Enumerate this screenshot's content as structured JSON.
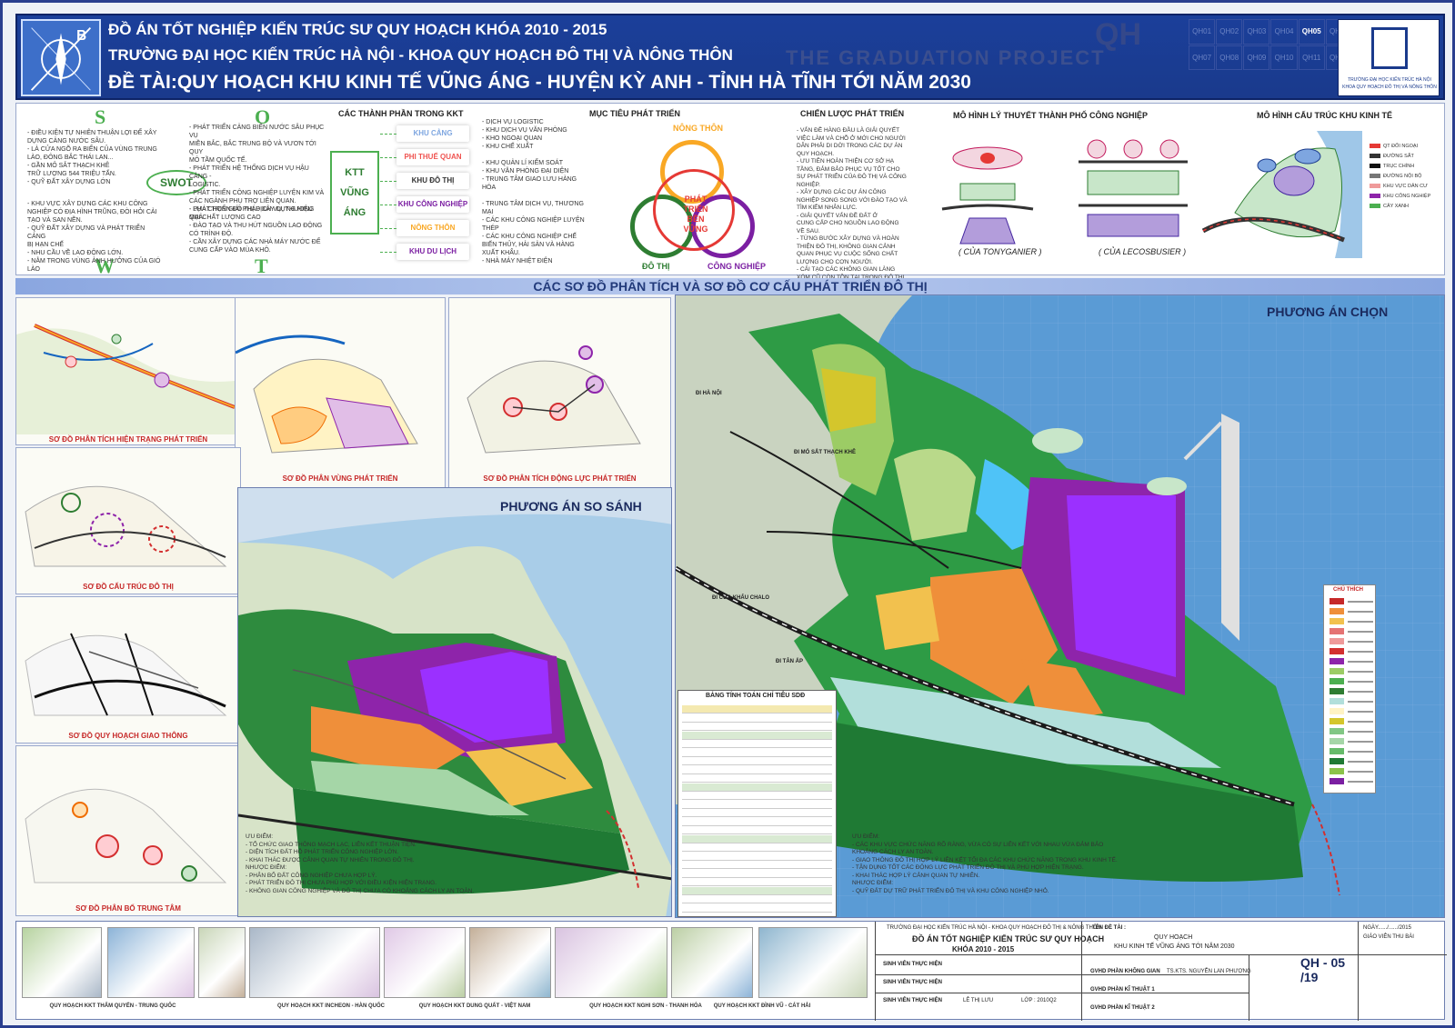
{
  "header": {
    "line1": "ĐỒ ÁN TỐT NGHIỆP KIẾN TRÚC SƯ QUY HOẠCH KHÓA 2010 - 2015",
    "line2": "TRƯỜNG ĐẠI HỌC KIẾN TRÚC HÀ NỘI - KHOA QUY HOẠCH ĐÔ THỊ VÀ NÔNG THÔN",
    "line3": "ĐỀ TÀI:QUY HOẠCH KHU KINH TẾ VŨNG ÁNG - HUYỆN KỲ ANH - TỈNH HÀ TĨNH TỚI NĂM 2030",
    "graduation": "THE GRADUATION PROJECT",
    "qh": "QH",
    "compass_letter": "B",
    "codes": [
      "QH01",
      "QH02",
      "QH03",
      "QH04",
      "QH05",
      "QH06",
      "QH07",
      "QH08",
      "QH09",
      "QH10",
      "QH11",
      "QH12"
    ],
    "active_code": "QH05",
    "logo_text": "TRƯỜNG ĐẠI HỌC KIẾN TRÚC HÀ NỘI\nKHOA QUY HOẠCH ĐÔ THỊ VÀ NÔNG THÔN"
  },
  "swot": {
    "s": "S",
    "o": "O",
    "w": "W",
    "t": "T",
    "center": "SWOT",
    "strengths": "- ĐIỀU KIỆN TỰ NHIÊN THUẬN LỢI ĐỂ XÂY\n  DỰNG CẢNG NƯỚC SÂU.\n- LÀ CỬA NGÕ RA BIỂN CỦA VÙNG TRUNG\n  LÀO, ĐÔNG BẮC THÁI LAN...\n- GẦN MỎ SẮT THẠCH KHÊ\n  TRỮ LƯỢNG 544 TRIỆU TẤN.\n- QUỸ ĐẤT XÂY DỰNG LỚN",
    "opportunities": "- PHÁT TRIỂN CẢNG BIỂN NƯỚC SÂU PHỤC VỤ\n  MIỀN BẮC, BẮC TRUNG BỘ VÀ VƯƠN TỚI QUY\n  MÔ TẦM QUỐC TẾ.\n- PHÁT TRIỂN HỆ THỐNG DỊCH VỤ HẬU CẢNG -\n  LOGISTIC.\n- PHÁT TRIỂN CÔNG NGHIỆP LUYỆN KIM VÀ\n  CÁC NGÀNH PHỤ TRỢ LIÊN QUAN.\n- PHÁT TRIỂN ĐÔ THỊ DỊCH VỤ, THƯƠNG\n  MẠI CHẤT LƯỢNG CAO",
    "weaknesses": "- KHU VỰC XÂY DỰNG CÁC KHU CÔNG\n  NGHIỆP CÓ ĐỊA HÌNH TRŨNG, ĐÒI HỎI CẢI\n  TẠO VÀ SAN NỀN.\n- QUỸ ĐẤT XÂY DỰNG VÀ PHÁT TRIỂN CẢNG\n  BỊ HẠN CHẾ\n- NHU CẦU VỀ LAO ĐỘNG LỚN.\n- NẰM TRONG VÙNG ẢNH HƯỞNG CỦA GIÓ\n  LÀO",
    "threats": "- LỰA CHỌN GIẢI PHÁP XÂY DỰNG HIỆU\n  QUẢ.\n- ĐÀO TẠO VÀ THU HÚT NGUỒN LAO ĐỘNG\n  CÓ TRÌNH ĐỘ.\n- CẦN XÂY DỰNG CÁC NHÀ MÁY NƯỚC ĐỂ\n  CUNG CẤP VÀO MÙA KHÔ."
  },
  "components": {
    "title": "CÁC THÀNH PHẦN TRONG KKT",
    "center": [
      "KTT",
      "VŨNG",
      "ÁNG"
    ],
    "zones": [
      {
        "label": "KHU CẢNG",
        "color": "#7ea6e0"
      },
      {
        "label": "PHI THUẾ QUAN",
        "color": "#ef5350"
      },
      {
        "label": "KHU ĐÔ THỊ",
        "color": "#333333"
      },
      {
        "label": "KHU CÔNG NGHIỆP",
        "color": "#7b1fa2"
      },
      {
        "label": "NÔNG THÔN",
        "color": "#f9a825"
      },
      {
        "label": "KHU DU LỊCH",
        "color": "#7b1fa2"
      }
    ],
    "details": "- DỊCH VỤ LOGISTIC\n- KHU DỊCH VỤ VĂN PHÒNG\n- KHO NGOẠI QUAN\n- KHU CHẾ XUẤT\n\n- KHU QUẢN LÍ KIỂM SOÁT\n- KHU VĂN PHÒNG ĐẠI DIỆN\n- TRUNG TÂM GIAO LƯU HÀNG\n  HÓA\n\n- TRUNG TÂM DỊCH VỤ, THƯƠNG\n  MẠI\n- CÁC KHU CÔNG NGHIỆP LUYỆN\n  THÉP\n- CÁC KHU CÔNG NGHIỆP CHẾ\n  BIẾN THỦY, HẢI SẢN VÀ HÀNG\n  XUẤT KHẨU.\n- NHÀ MÁY NHIỆT ĐIỆN"
  },
  "goals": {
    "title": "MỤC TIÊU PHÁT TRIỂN",
    "center": "PHÁT TRIỂN\nBỀN\nVỮNG",
    "top": "NÔNG THÔN",
    "left": "ĐÔ THỊ",
    "right": "CÔNG NGHIỆP"
  },
  "strategy": {
    "title": "CHIẾN LƯỢC PHÁT TRIỂN",
    "text": "- VẤN ĐỀ HÀNG ĐẦU LÀ GIẢI QUYẾT\n  VIỆC LÀM VÀ CHỖ Ở MỚI CHO NGƯỜI\n  DÂN PHẢI DI DỜI TRONG CÁC DỰ ÁN\n  QUY HOẠCH.\n- ƯU TIÊN HOÀN THIỆN CƠ SỞ HẠ\n  TẦNG, ĐẢM BẢO PHỤC VỤ TỐT CHO\n  SỰ PHÁT TRIỂN CỦA ĐÔ THỊ VÀ CÔNG\n  NGHIỆP.\n- XÂY DỰNG CÁC DỰ ÁN CÔNG\n  NGHIỆP SONG SONG VỚI ĐÀO TẠO VÀ\n  TÌM KIẾM NHÂN LỰC.\n- GIẢI QUYẾT VẤN ĐỀ ĐẤT Ở\n  CUNG CẤP CHO NGUỒN LAO ĐỘNG\n  VỀ SAU.\n- TỪNG BƯỚC XÂY DỰNG VÀ HOÀN\n  THIỆN ĐÔ THỊ, KHÔNG GIAN CẢNH\n  QUAN PHỤC VỤ CUỘC SỐNG CHẤT\n  LƯỢNG CHO CƠN NGƯỜI.\n- CẢI TẠO CÁC KHÔNG GIAN LÀNG\n  XÓM CŨ CÒN TỒN TẠI TRONG ĐÔ THỊ,\n  ĐẢM BẢO SỰ HÀI HÒA VỚI KHÔNG\n  GIAN ĐÔ THỊ."
  },
  "models": {
    "title1": "MÔ HÌNH LÝ THUYẾT THÀNH PHỐ CÔNG NGHIỆP",
    "title2": "MÔ HÌNH CẤU TRÚC KHU KINH TẾ",
    "cap1": "( CỦA TONYGANIER )",
    "cap2": "( CỦA LECOSBUSIER )",
    "legend": [
      "QT ĐỐI NGOẠI",
      "ĐƯỜNG SẮT",
      "TRỤC CHÍNH",
      "ĐƯỜNG NỘI BỘ",
      "KHU VỰC DÂN CƯ",
      "KHU CÔNG NGHIỆP",
      "CÂY XANH"
    ]
  },
  "banner": "CÁC SƠ ĐỒ PHÂN TÍCH VÀ SƠ ĐỒ CƠ CẤU PHÁT TRIỂN ĐÔ THỊ",
  "diagrams": {
    "d1": "SƠ ĐỒ PHÂN TÍCH HIỆN TRẠNG PHÁT TRIỂN",
    "d2": "SƠ ĐỒ PHÂN VÙNG PHÁT TRIỂN",
    "d3": "SƠ ĐỒ PHÂN TÍCH ĐỘNG LỰC PHÁT TRIỂN",
    "d4": "SƠ ĐỒ CẤU TRÚC ĐÔ THỊ",
    "d5": "SƠ ĐỒ QUY HOẠCH GIAO THÔNG",
    "d6": "SƠ ĐỒ PHÂN BỐ TRUNG TÂM"
  },
  "maps": {
    "compare_title": "PHƯƠNG ÁN SO SÁNH",
    "chosen_title": "PHƯƠNG ÁN CHỌN",
    "table_title": "BẢNG TÍNH TOÁN CHỈ TIÊU SDĐ",
    "labels": [
      "ĐI HÀ NỘI",
      "ĐI MỎ SẮT THẠCH KHÊ",
      "ĐI CỬA KHẨU CHALO",
      "ĐI TÂN ẤP"
    ],
    "compare_notes": "ƯU ĐIỂM:\n- TỔ CHỨC GIAO THÔNG MẠCH LẠC, LIÊN KẾT THUẬN TIỆN.\n- DIỆN TÍCH ĐẤT HỖ PHÁT TRIỂN CÔNG NGHIỆP LỚN.\n- KHAI THÁC ĐƯỢC CẢNH QUAN TỰ NHIÊN TRONG ĐÔ THỊ.\nNHƯỢC ĐIỂM:\n- PHÂN BỐ ĐẤT CÔNG NGHIỆP CHƯA HỢP LÝ.\n- PHÁT TRIỂN ĐÔ THỊ CHƯA PHÙ HỢP VỚI ĐIỀU KIỆN HIỆN TRẠNG.\n- KHÔNG GIAN CÔNG NGHIỆP VÀ ĐÔ THỊ CHƯA CÓ KHOẢNG CÁCH LY AN TOÀN.",
    "chosen_notes": "ƯU ĐIỂM:\n- CÁC KHU VỰC CHỨC NĂNG RÕ RÀNG, VỪA CÓ SỰ LIÊN KẾT VỚI NHAU VỪA ĐẢM BẢO\n  KHOẢNG CÁCH LY AN TOÀN.\n- GIAO THÔNG ĐÔ THỊ HỢP LÝ LIÊN KẾT TỐI ĐA CÁC KHU CHỨC NĂNG TRONG KHU KINH TẾ.\n- TẬN DỤNG TỐT CÁC ĐỘNG LỰC PHÁT TRIỂN ĐÔ THỊ VÀ PHÙ HỢP HIỆN TRẠNG.\n- KHAI THÁC HỢP LÝ CẢNH QUAN TỰ NHIÊN.\nNHƯỢC ĐIỂM:\n- QUỸ ĐẤT DỰ TRỮ PHÁT TRIỂN ĐÔ THỊ VÀ KHU CÔNG NGHIỆP NHỎ.",
    "legend_title": "CHÚ THÍCH"
  },
  "references": [
    {
      "caption": "QUY HOẠCH KKT THẨM QUYẾN - TRUNG QUỐC"
    },
    {
      "caption": "QUY HOẠCH KKT INCHEON - HÀN QUỐC"
    },
    {
      "caption": "QUY HOẠCH KKT DUNG QUẤT - VIỆT NAM"
    },
    {
      "caption": "QUY HOẠCH KKT NGHI SƠN - THANH HÓA"
    },
    {
      "caption": "QUY HOẠCH KKT ĐÌNH VŨ - CÁT HẢI"
    }
  ],
  "titleblock": {
    "school": "TRƯỜNG ĐẠI HỌC KIẾN TRÚC HÀ NỘI - KHOA QUY HOẠCH ĐÔ THỊ & NÔNG THÔN",
    "project": "ĐỒ ÁN TỐT NGHIỆP KIẾN TRÚC SƯ QUY HOẠCH",
    "course": "KHÓA 2010 - 2015",
    "topic_label": "TÊN ĐỀ TÀI :",
    "topic1": "QUY HOẠCH",
    "topic2": "KHU KINH TẾ VŨNG ÁNG TỚI NĂM 2030",
    "student_label": "SINH VIÊN THỰC HIỆN",
    "student": "LÊ THỊ LƯU",
    "class": "LỚP : 2010Q2",
    "gv1_label": "GVHD PHẦN KHÔNG GIAN",
    "gv1": "TS.KTS. NGUYỄN LAN PHƯƠNG",
    "gv2_label": "GVHD PHẦN KĨ THUẬT 1",
    "gv3_label": "GVHD PHẦN KĨ THUẬT 2",
    "date": "NGÀY....../....../2015",
    "approve": "GIÁO VIÊN THU BÀI",
    "sheet": "QH - 05 /19"
  },
  "colors": {
    "header": "#1a3a8c",
    "industrial": "#8e24aa",
    "urban": "#ef8f3a",
    "green": "#2e8b3e",
    "sea": "#5a9bd5"
  }
}
